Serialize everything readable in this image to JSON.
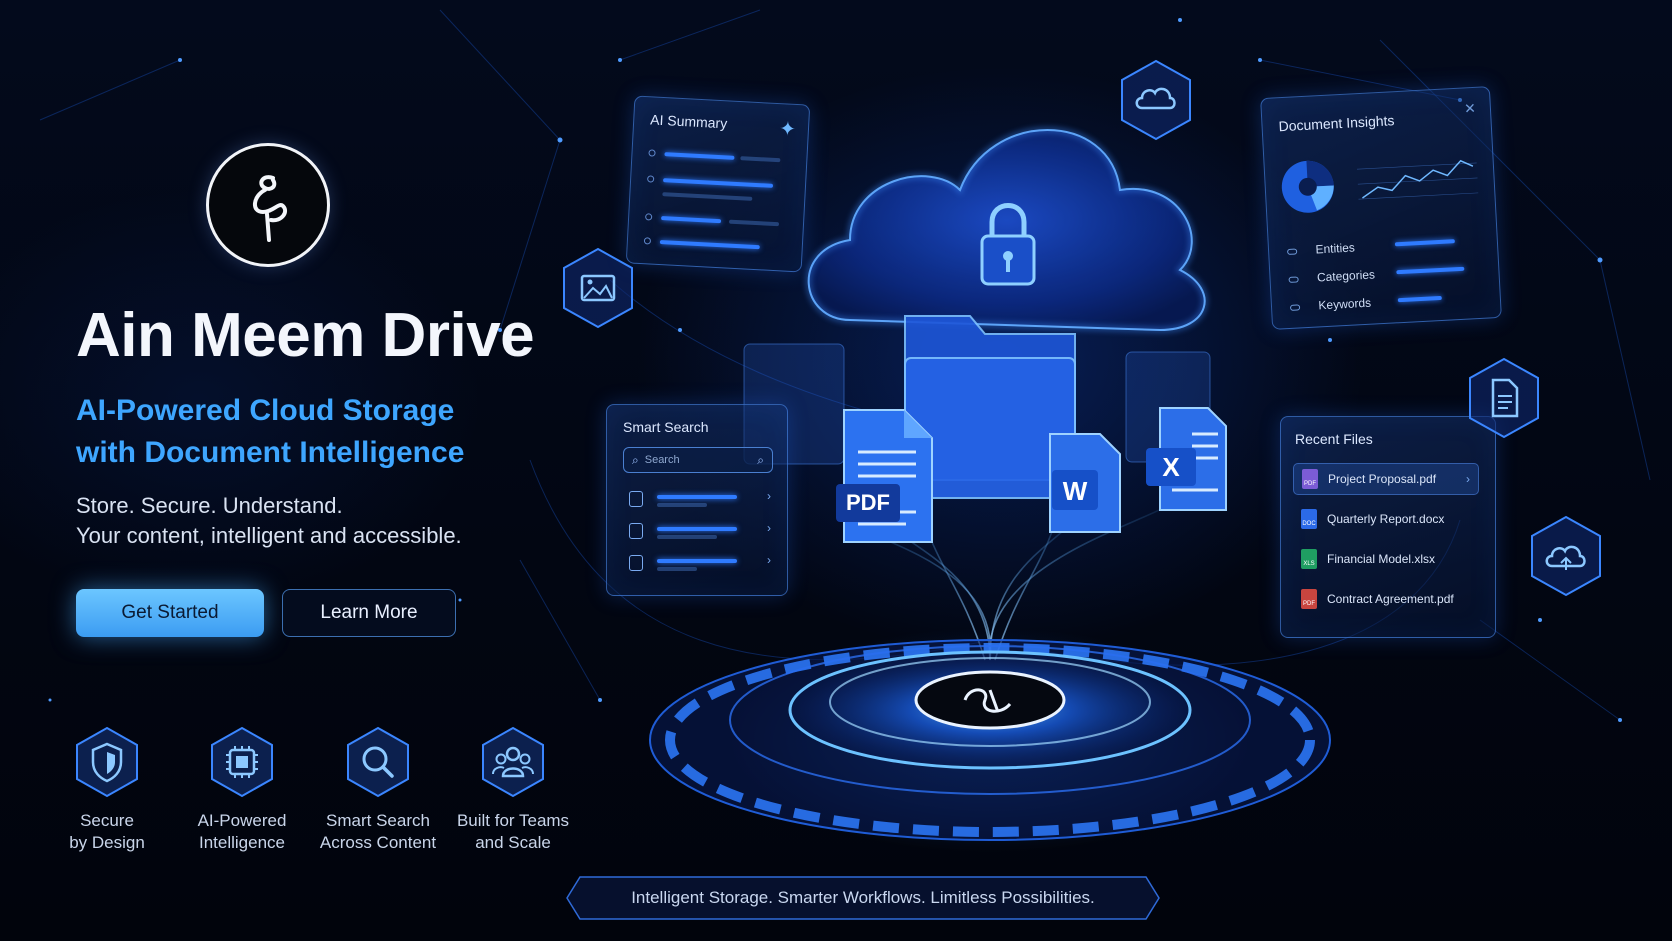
{
  "brand": {
    "title": "Ain Meem Drive",
    "subtitle_line1": "AI-Powered Cloud Storage",
    "subtitle_line2": "with Document Intelligence",
    "tagline_line1": "Store. Secure. Understand.",
    "tagline_line2": "Your content, intelligent and accessible.",
    "logo_icon": "ain-meem-monogram"
  },
  "cta": {
    "primary_label": "Get Started",
    "secondary_label": "Learn More"
  },
  "features": [
    {
      "label": "Secure\nby Design",
      "icon": "shield-icon"
    },
    {
      "label": "AI-Powered\nIntelligence",
      "icon": "chip-icon"
    },
    {
      "label": "Smart Search\nAcross Content",
      "icon": "search-icon"
    },
    {
      "label": "Built for Teams\nand Scale",
      "icon": "team-icon"
    }
  ],
  "panels": {
    "ai_summary": {
      "title": "AI Summary"
    },
    "smart_search": {
      "title": "Smart Search",
      "placeholder": "Search"
    },
    "document_insights": {
      "title": "Document Insights",
      "rows": [
        "Entities",
        "Categories",
        "Keywords"
      ]
    },
    "recent_files": {
      "title": "Recent Files",
      "files": [
        {
          "name": "Project Proposal.pdf",
          "type": "PDF"
        },
        {
          "name": "Quarterly Report.docx",
          "type": "DOC"
        },
        {
          "name": "Financial Model.xlsx",
          "type": "XLS"
        },
        {
          "name": "Contract Agreement.pdf",
          "type": "PDF"
        }
      ]
    }
  },
  "file_badges": {
    "pdf": "PDF",
    "word": "W",
    "excel": "X"
  },
  "footer": {
    "slogan": "Intelligent Storage. Smarter Workflows. Limitless Possibilities."
  },
  "colors": {
    "accent": "#3ea6ff",
    "primary_button": "#5bb8ff",
    "background": "#020714",
    "glow": "#2f7bff"
  }
}
